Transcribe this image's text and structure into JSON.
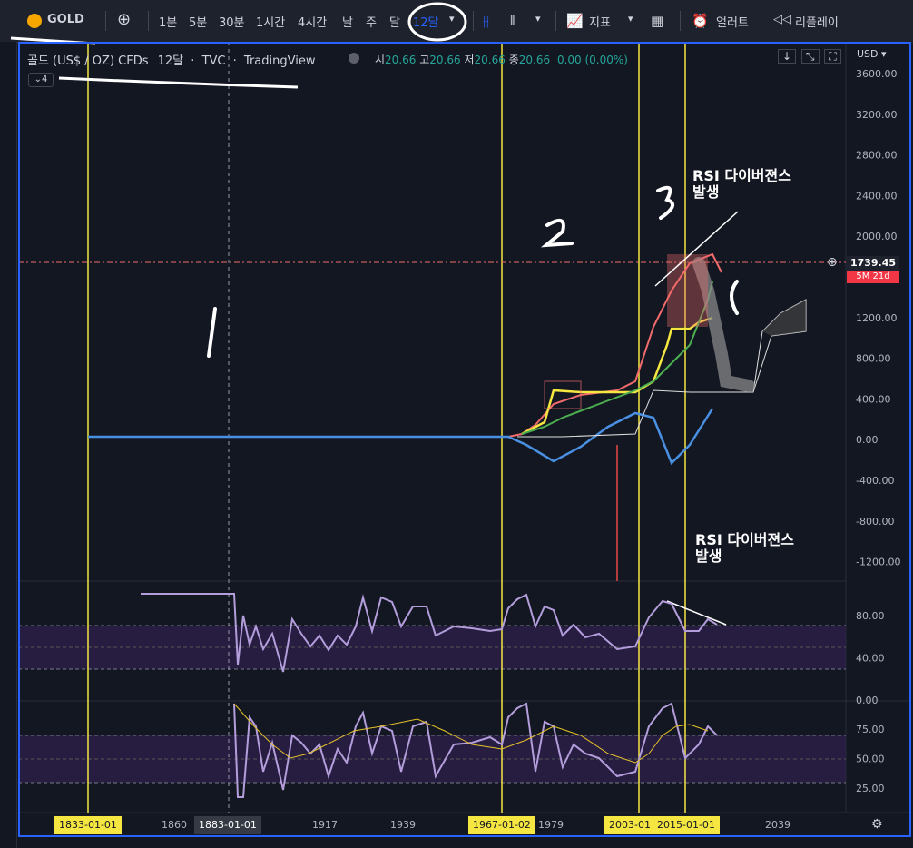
{
  "toolbar": {
    "symbol": "GOLD",
    "intervals": [
      "1분",
      "5분",
      "30분",
      "1시간",
      "4시간",
      "날",
      "주",
      "달"
    ],
    "active_interval": "12달",
    "indicators_label": "지표",
    "alert_label": "얼러트",
    "replay_label": "리플레이"
  },
  "legend": {
    "title": "골드 (US$ / OZ) CFDs",
    "interval": "12달",
    "source": "TVC",
    "platform": "TradingView",
    "open_label": "시",
    "open": "20.66",
    "high_label": "고",
    "high": "20.66",
    "low_label": "저",
    "low": "20.66",
    "close_label": "종",
    "close": "20.66",
    "change": "0.00 (0.00%)",
    "collapsed_count": "4"
  },
  "price_axis": {
    "currency": "USD",
    "ticks": [
      "3600.00",
      "3200.00",
      "2800.00",
      "2400.00",
      "2000.00",
      "1600.00",
      "1200.00",
      "800.00",
      "400.00",
      "0.00",
      "-400.00",
      "-800.00",
      "-1200.00"
    ],
    "current_price": "1739.45",
    "countdown": "5M 21d"
  },
  "rsi1_axis": {
    "ticks": [
      "80.00",
      "40.00",
      "0.00"
    ]
  },
  "rsi2_axis": {
    "ticks": [
      "75.00",
      "50.00",
      "25.00"
    ]
  },
  "time_axis": {
    "labels": [
      "1860",
      "1917",
      "1939",
      "1979",
      "2039"
    ],
    "highlighted": [
      "1833-01-01",
      "1883-01-01",
      "1967-01-02",
      "2003-01",
      "2015-01-01"
    ]
  },
  "annotations": {
    "rsi_div_top": [
      "RSI 다이버젼스",
      "발생"
    ],
    "rsi_div_bottom": [
      "RSI 다이버젼스",
      "발생"
    ]
  },
  "colors": {
    "bg": "#131722",
    "vline": "#f5e642",
    "rsi_line": "#b39ddb",
    "rsi_ma": "#e6c229",
    "bb_red": "#f06b6b",
    "bb_yellow": "#f5e642",
    "bb_green": "#4caf50",
    "bb_blue": "#4a90e2"
  }
}
